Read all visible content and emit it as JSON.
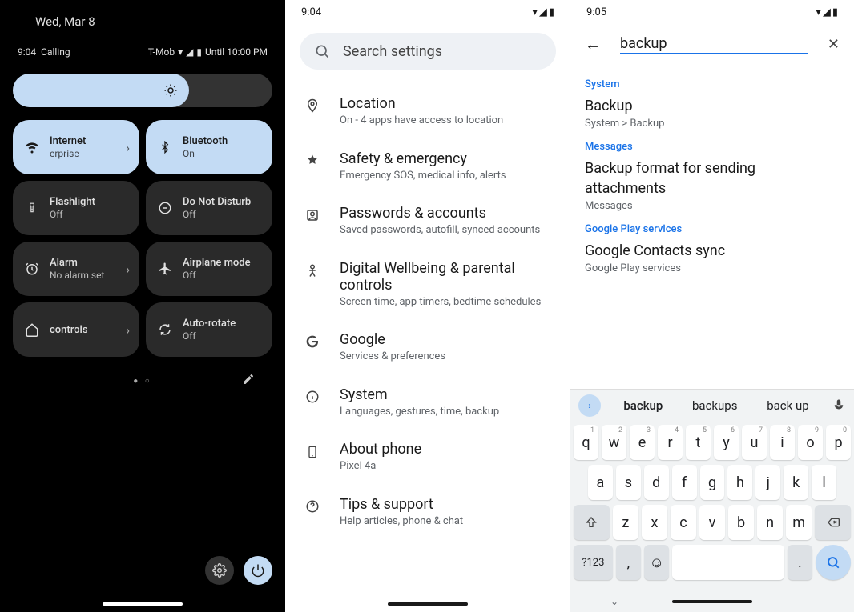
{
  "panel1": {
    "date": "Wed, Mar 8",
    "time": "9:04",
    "calling": "Calling",
    "carrier": "T-Mob",
    "alarm_until": "Until 10:00 PM",
    "tiles": [
      {
        "title": "Internet",
        "sub": "erprise",
        "on": true,
        "chev": true
      },
      {
        "title": "Bluetooth",
        "sub": "On",
        "on": true,
        "chev": false
      },
      {
        "title": "Flashlight",
        "sub": "Off",
        "on": false,
        "chev": false
      },
      {
        "title": "Do Not Disturb",
        "sub": "Off",
        "on": false,
        "chev": false
      },
      {
        "title": "Alarm",
        "sub": "No alarm set",
        "on": false,
        "chev": true
      },
      {
        "title": "Airplane mode",
        "sub": "Off",
        "on": false,
        "chev": false
      },
      {
        "title": "controls",
        "sub": "",
        "on": false,
        "chev": true
      },
      {
        "title": "Auto-rotate",
        "sub": "Off",
        "on": false,
        "chev": false
      }
    ]
  },
  "panel2": {
    "time": "9:04",
    "search_placeholder": "Search settings",
    "items": [
      {
        "title": "Location",
        "sub": "On - 4 apps have access to location"
      },
      {
        "title": "Safety & emergency",
        "sub": "Emergency SOS, medical info, alerts"
      },
      {
        "title": "Passwords & accounts",
        "sub": "Saved passwords, autofill, synced accounts"
      },
      {
        "title": "Digital Wellbeing & parental controls",
        "sub": "Screen time, app timers, bedtime schedules"
      },
      {
        "title": "Google",
        "sub": "Services & preferences"
      },
      {
        "title": "System",
        "sub": "Languages, gestures, time, backup"
      },
      {
        "title": "About phone",
        "sub": "Pixel 4a"
      },
      {
        "title": "Tips & support",
        "sub": "Help articles, phone & chat"
      }
    ]
  },
  "panel3": {
    "time": "9:05",
    "query": "backup",
    "categories": [
      {
        "name": "System",
        "results": [
          {
            "title": "Backup",
            "sub": "System > Backup"
          }
        ]
      },
      {
        "name": "Messages",
        "results": [
          {
            "title": "Backup format for sending attachments",
            "sub": "Messages"
          }
        ]
      },
      {
        "name": "Google Play services",
        "results": [
          {
            "title": "Google Contacts sync",
            "sub": "Google Play services"
          }
        ]
      }
    ],
    "suggestions": [
      "backup",
      "backups",
      "back up"
    ],
    "kbd": {
      "row1": [
        [
          "q",
          "1"
        ],
        [
          "w",
          "2"
        ],
        [
          "e",
          "3"
        ],
        [
          "r",
          "4"
        ],
        [
          "t",
          "5"
        ],
        [
          "y",
          "6"
        ],
        [
          "u",
          "7"
        ],
        [
          "i",
          "8"
        ],
        [
          "o",
          "9"
        ],
        [
          "p",
          "0"
        ]
      ],
      "row2": [
        "a",
        "s",
        "d",
        "f",
        "g",
        "h",
        "j",
        "k",
        "l"
      ],
      "row3": [
        "z",
        "x",
        "c",
        "v",
        "b",
        "n",
        "m"
      ],
      "sym": "?123",
      "comma": ",",
      "period": "."
    }
  }
}
